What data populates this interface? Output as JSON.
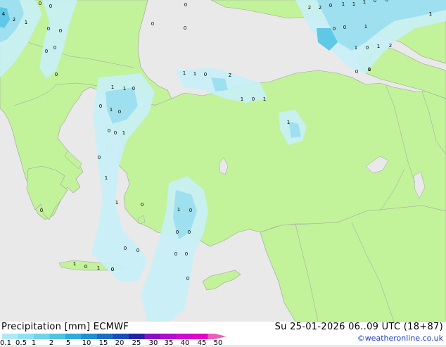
{
  "footer": {
    "title": "Precipitation [mm]  ECMWF",
    "run": "Su 25-01-2026 06..09 UTC (18+87)",
    "credit": "©weatheronline.co.uk"
  },
  "legend": {
    "ticks": [
      "0.1",
      "0.5",
      "1",
      "2",
      "5",
      "10",
      "15",
      "20",
      "25",
      "30",
      "35",
      "40",
      "45",
      "50"
    ],
    "colors": [
      "#aeeaf6",
      "#8fe0f2",
      "#6fd3ea",
      "#4fc3e2",
      "#2eaadc",
      "#1f8fd0",
      "#1c6cc4",
      "#1a4db8",
      "#2222a8",
      "#8a0ec6",
      "#b10ccf",
      "#cf0ad2",
      "#e008c4",
      "#e860b8"
    ]
  },
  "colors": {
    "sea": "#e9e9e9",
    "land": "#c2f29a",
    "border": "#a0a0a0",
    "precip_light": "#c8f0f8",
    "precip_mid": "#9fe0f0",
    "precip_heavy": "#5fc8e6"
  },
  "map_labels": [
    {
      "t": "4"
    },
    {
      "t": "2"
    },
    {
      "t": "1"
    },
    {
      "t": "0"
    },
    {
      "t": "0"
    },
    {
      "t": "0"
    },
    {
      "t": "0"
    },
    {
      "t": "0"
    },
    {
      "t": "0"
    },
    {
      "t": "0"
    },
    {
      "t": "0"
    },
    {
      "t": "2"
    },
    {
      "t": "2"
    },
    {
      "t": "0"
    },
    {
      "t": "1"
    },
    {
      "t": "1"
    },
    {
      "t": "1"
    },
    {
      "t": "0"
    },
    {
      "t": "0"
    },
    {
      "t": "0"
    },
    {
      "t": "1"
    },
    {
      "t": "1"
    },
    {
      "t": "1"
    },
    {
      "t": "0"
    },
    {
      "t": "1"
    },
    {
      "t": "2"
    },
    {
      "t": "0"
    },
    {
      "t": "0"
    },
    {
      "t": "0"
    },
    {
      "t": "0"
    },
    {
      "t": "1"
    },
    {
      "t": "1"
    },
    {
      "t": "0"
    },
    {
      "t": "2"
    },
    {
      "t": "1"
    },
    {
      "t": "0"
    },
    {
      "t": "1"
    },
    {
      "t": "1"
    },
    {
      "t": "1"
    },
    {
      "t": "0"
    },
    {
      "t": "0"
    },
    {
      "t": "1"
    },
    {
      "t": "0"
    },
    {
      "t": "0"
    },
    {
      "t": "0"
    },
    {
      "t": "1"
    },
    {
      "t": "0"
    },
    {
      "t": "1"
    },
    {
      "t": "1"
    },
    {
      "t": "0"
    },
    {
      "t": "0"
    },
    {
      "t": "1"
    },
    {
      "t": "0"
    },
    {
      "t": "0"
    },
    {
      "t": "0"
    },
    {
      "t": "0"
    },
    {
      "t": "0"
    },
    {
      "t": "0"
    },
    {
      "t": "0"
    },
    {
      "t": "1"
    },
    {
      "t": "0"
    },
    {
      "t": "1"
    },
    {
      "t": "0"
    },
    {
      "t": "0"
    },
    {
      "t": "0"
    },
    {
      "t": "1"
    },
    {
      "t": "1"
    },
    {
      "t": "1"
    },
    {
      "t": "0"
    }
  ]
}
